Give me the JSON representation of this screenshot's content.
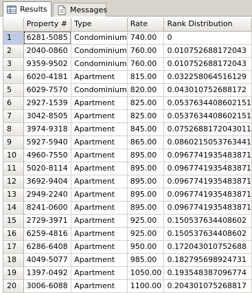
{
  "tabs": [
    {
      "label": "Results",
      "icon": "grid-results-icon",
      "active": true
    },
    {
      "label": "Messages",
      "icon": "messages-icon",
      "active": false
    }
  ],
  "columns": [
    "",
    "Property #",
    "Type",
    "Rate",
    "Rank Distribution"
  ],
  "selected_row": 1,
  "rows": [
    {
      "num": "1",
      "property": "6281-5085",
      "type": "Condominium",
      "rate": "740.00",
      "rank": "0"
    },
    {
      "num": "2",
      "property": "2040-0860",
      "type": "Condominium",
      "rate": "760.00",
      "rank": "0.010752688172043"
    },
    {
      "num": "3",
      "property": "9359-9502",
      "type": "Condominium",
      "rate": "760.00",
      "rank": "0.010752688172043"
    },
    {
      "num": "4",
      "property": "6020-4181",
      "type": "Apartment",
      "rate": "815.00",
      "rank": "0.032258064516129"
    },
    {
      "num": "5",
      "property": "6029-7570",
      "type": "Condominium",
      "rate": "820.00",
      "rank": "0.043010752688172"
    },
    {
      "num": "6",
      "property": "2927-1539",
      "type": "Apartment",
      "rate": "825.00",
      "rank": "0.0537634408602151"
    },
    {
      "num": "7",
      "property": "3042-8505",
      "type": "Apartment",
      "rate": "825.00",
      "rank": "0.0537634408602151"
    },
    {
      "num": "8",
      "property": "3974-9318",
      "type": "Apartment",
      "rate": "845.00",
      "rank": "0.0752688172043011"
    },
    {
      "num": "9",
      "property": "5927-5940",
      "type": "Apartment",
      "rate": "865.00",
      "rank": "0.0860215053763441"
    },
    {
      "num": "10",
      "property": "4960-7550",
      "type": "Apartment",
      "rate": "895.00",
      "rank": "0.0967741935483871"
    },
    {
      "num": "11",
      "property": "5020-8114",
      "type": "Apartment",
      "rate": "895.00",
      "rank": "0.0967741935483871"
    },
    {
      "num": "12",
      "property": "3692-9404",
      "type": "Apartment",
      "rate": "895.00",
      "rank": "0.0967741935483871"
    },
    {
      "num": "13",
      "property": "2949-2240",
      "type": "Apartment",
      "rate": "895.00",
      "rank": "0.0967741935483871"
    },
    {
      "num": "14",
      "property": "8241-0600",
      "type": "Apartment",
      "rate": "895.00",
      "rank": "0.0967741935483871"
    },
    {
      "num": "15",
      "property": "2729-3971",
      "type": "Apartment",
      "rate": "925.00",
      "rank": "0.150537634408602"
    },
    {
      "num": "16",
      "property": "6259-4816",
      "type": "Apartment",
      "rate": "925.00",
      "rank": "0.150537634408602"
    },
    {
      "num": "17",
      "property": "6286-6408",
      "type": "Apartment",
      "rate": "950.00",
      "rank": "0.172043010752688"
    },
    {
      "num": "18",
      "property": "4049-5077",
      "type": "Apartment",
      "rate": "985.00",
      "rank": "0.182795698924731"
    },
    {
      "num": "19",
      "property": "1397-0492",
      "type": "Apartment",
      "rate": "1050.00",
      "rank": "0.193548387096774"
    },
    {
      "num": "20",
      "property": "3006-6088",
      "type": "Apartment",
      "rate": "1100.00",
      "rank": "0.204301075268817"
    }
  ]
}
